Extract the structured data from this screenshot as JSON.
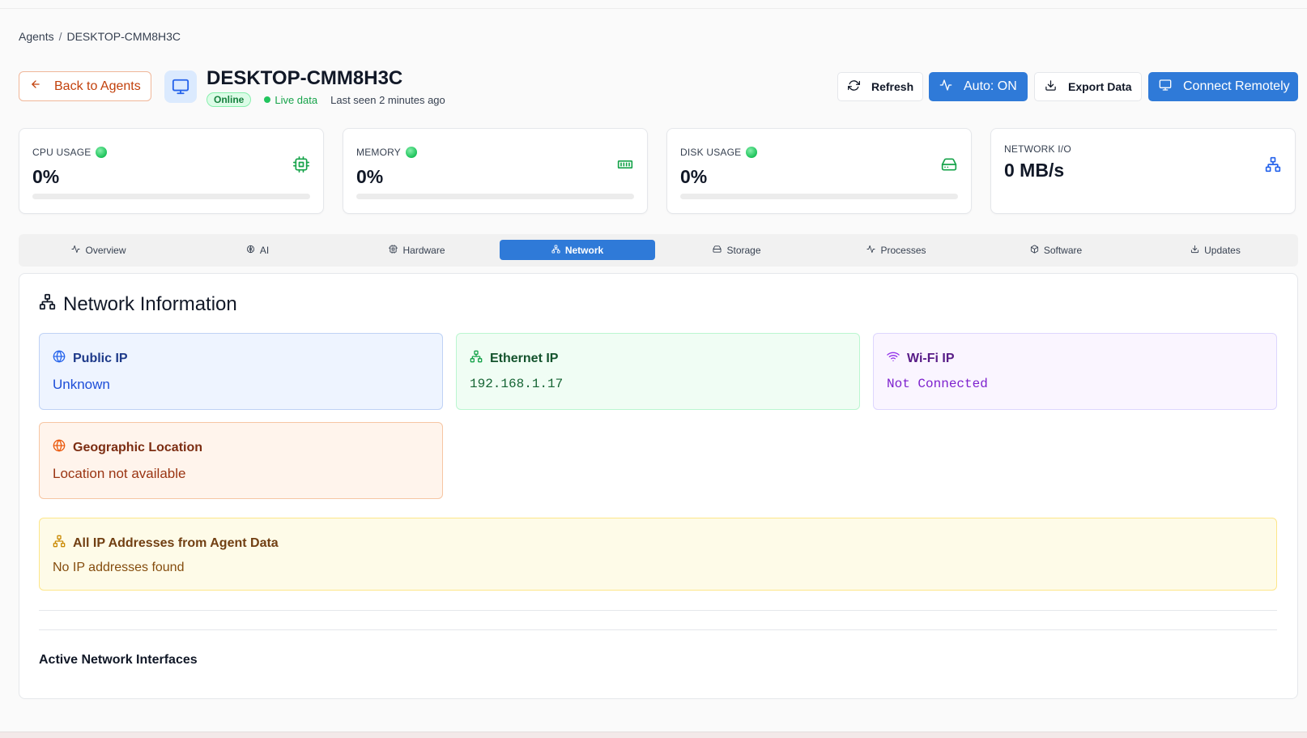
{
  "breadcrumb": {
    "root": "Agents",
    "separator": "/",
    "current": "DESKTOP-CMM8H3C"
  },
  "header": {
    "back_label": "Back to Agents",
    "host_name": "DESKTOP-CMM8H3C",
    "status_badge": "Online",
    "live_label": "Live data",
    "last_seen": "Last seen 2 minutes ago"
  },
  "toolbar": {
    "refresh_label": "Refresh",
    "auto_label": "Auto: ON",
    "export_label": "Export Data",
    "connect_label": "Connect Remotely"
  },
  "metrics": {
    "cpu": {
      "label": "CPU USAGE",
      "value": "0%",
      "fill": 0
    },
    "memory": {
      "label": "MEMORY",
      "value": "0%",
      "fill": 0
    },
    "disk": {
      "label": "DISK USAGE",
      "value": "0%",
      "fill": 0
    },
    "network": {
      "label": "NETWORK I/O",
      "value": "0 MB/s"
    }
  },
  "tabs": [
    {
      "label": "Overview",
      "icon": "activity-icon"
    },
    {
      "label": "AI",
      "icon": "brain-icon"
    },
    {
      "label": "Hardware",
      "icon": "cpu-icon"
    },
    {
      "label": "Network",
      "icon": "network-icon",
      "active": true
    },
    {
      "label": "Storage",
      "icon": "hard-drive-icon"
    },
    {
      "label": "Processes",
      "icon": "activity-icon"
    },
    {
      "label": "Software",
      "icon": "package-icon"
    },
    {
      "label": "Updates",
      "icon": "download-icon"
    }
  ],
  "network_panel": {
    "title": "Network Information",
    "public_ip": {
      "label": "Public IP",
      "value": "Unknown"
    },
    "ethernet_ip": {
      "label": "Ethernet IP",
      "value": "192.168.1.17"
    },
    "wifi_ip": {
      "label": "Wi-Fi IP",
      "value": "Not Connected"
    },
    "geo": {
      "label": "Geographic Location",
      "value": "Location not available"
    },
    "all_ips": {
      "label": "All IP Addresses from Agent Data",
      "value": "No IP addresses found"
    },
    "interfaces_title": "Active Network Interfaces"
  },
  "colors": {
    "accent": "#2f7ad8",
    "success": "#22c55e",
    "back_button": "#c2410c"
  }
}
